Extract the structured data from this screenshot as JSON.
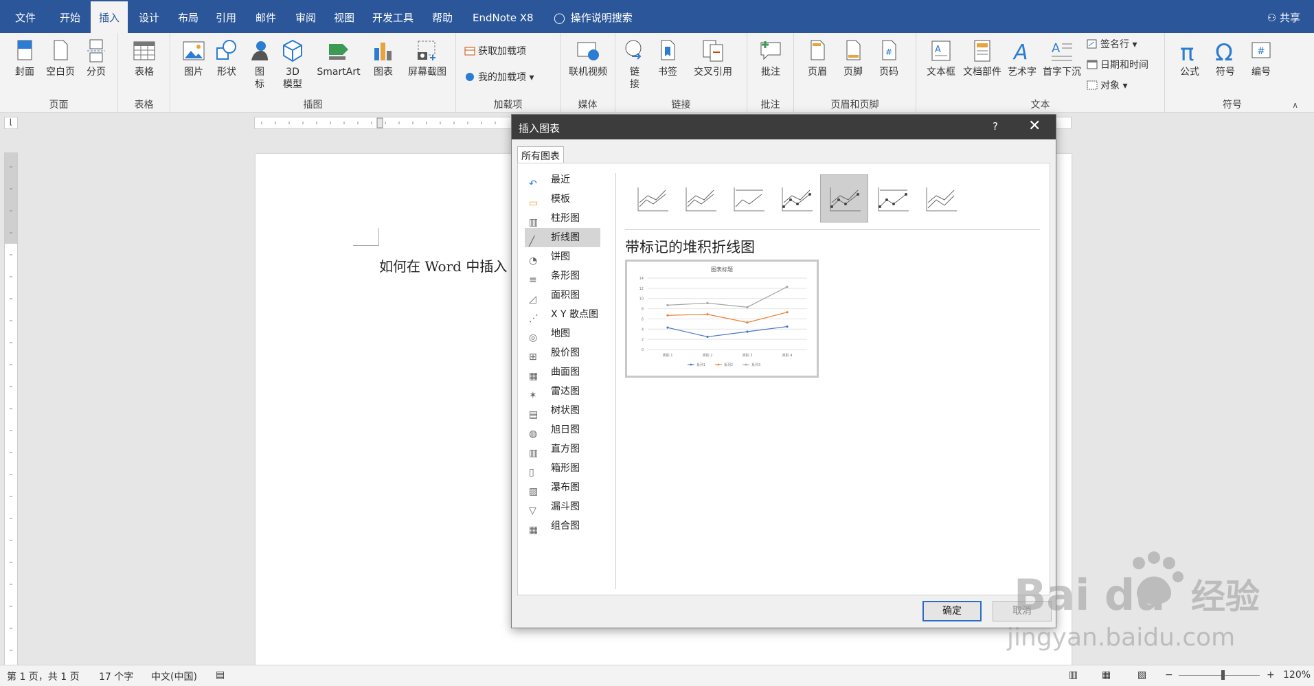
{
  "tabs": [
    "文件",
    "开始",
    "插入",
    "设计",
    "布局",
    "引用",
    "邮件",
    "审阅",
    "视图",
    "开发工具",
    "帮助",
    "EndNote X8"
  ],
  "active_tab": "插入",
  "search_label": "操作说明搜索",
  "share_label": "共享",
  "ribbon": {
    "groups": {
      "pages": "页面",
      "tables": "表格",
      "illustrations": "插图",
      "addins": "加载项",
      "media": "媒体",
      "links": "链接",
      "comments": "批注",
      "header_footer": "页眉和页脚",
      "text": "文本",
      "symbols": "符号"
    },
    "buttons": {
      "cover": "封面",
      "blank_page": "空白页",
      "page_break": "分页",
      "table": "表格",
      "picture": "图片",
      "shapes": "形状",
      "icons": "图\n标",
      "model3d": "3D\n模型",
      "smartart": "SmartArt",
      "chart": "图表",
      "screenshot": "屏幕截图",
      "get_addins": "获取加载项",
      "my_addins": "我的加载项",
      "online_video": "联机视频",
      "link": "链\n接",
      "bookmark": "书签",
      "cross_ref": "交叉引用",
      "comment": "批注",
      "header": "页眉",
      "footer": "页脚",
      "page_number": "页码",
      "textbox": "文本框",
      "quick_parts": "文档部件",
      "wordart": "艺术字",
      "dropcap": "首字下沉",
      "signature": "签名行",
      "datetime": "日期和时间",
      "object": "对象",
      "equation": "公式",
      "symbol": "符号",
      "number": "编号"
    }
  },
  "doc_text": "如何在 Word 中插入",
  "status": {
    "page": "第 1 页，共 1 页",
    "words": "17 个字",
    "lang": "中文(中国)",
    "zoom": "120%"
  },
  "dialog": {
    "title": "插入图表",
    "help": "?",
    "close": "✕",
    "tab": "所有图表",
    "categories": [
      "最近",
      "模板",
      "柱形图",
      "折线图",
      "饼图",
      "条形图",
      "面积图",
      "X Y 散点图",
      "地图",
      "股价图",
      "曲面图",
      "雷达图",
      "树状图",
      "旭日图",
      "直方图",
      "箱形图",
      "瀑布图",
      "漏斗图",
      "组合图"
    ],
    "selected_category": "折线图",
    "subtype_title": "带标记的堆积折线图",
    "ok": "确定",
    "cancel": "取消"
  },
  "chart_data": {
    "type": "line",
    "title": "图表标题",
    "categories": [
      "类别 1",
      "类别 2",
      "类别 3",
      "类别 4"
    ],
    "series": [
      {
        "name": "系列1",
        "values": [
          4.3,
          2.5,
          3.5,
          4.5
        ],
        "color": "#4472c4"
      },
      {
        "name": "系列2",
        "values": [
          6.7,
          6.9,
          5.3,
          7.3
        ],
        "color": "#ed7d31"
      },
      {
        "name": "系列3",
        "values": [
          8.7,
          9.1,
          8.3,
          12.3
        ],
        "color": "#a5a5a5"
      }
    ],
    "ylim": [
      0,
      14
    ],
    "yticks": [
      "0",
      "2",
      "4",
      "6",
      "8",
      "10",
      "12",
      "14"
    ],
    "grid": true,
    "legend": "bottom"
  },
  "watermark": {
    "brand": "Bai du",
    "suffix": "经验",
    "url": "jingyan.baidu.com"
  }
}
